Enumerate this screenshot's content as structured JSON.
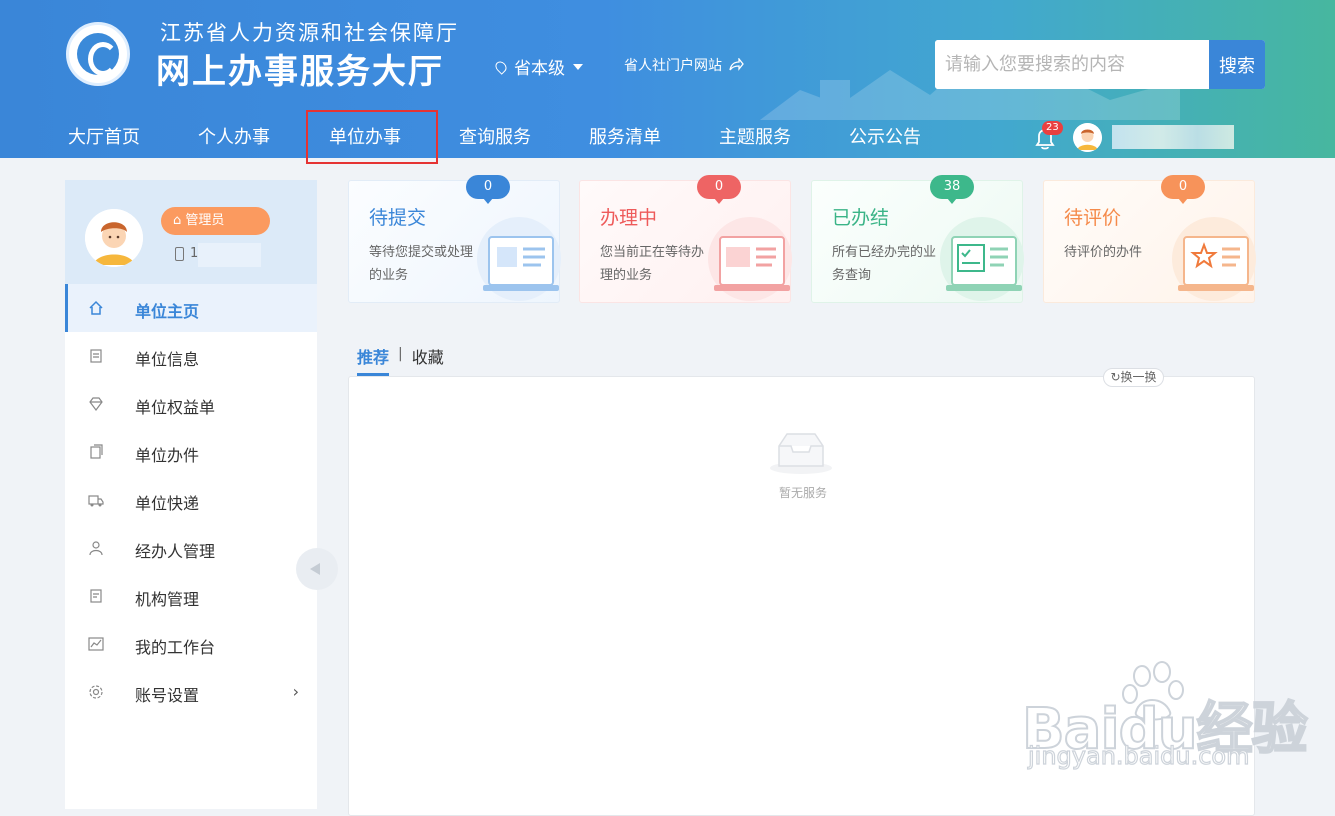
{
  "header": {
    "org_name": "江苏省人力资源和社会保障厅",
    "site_title": "网上办事服务大厅",
    "region": "省本级",
    "portal_link": "省人社门户网站",
    "search_placeholder": "请输入您要搜索的内容",
    "search_button": "搜索",
    "notification_count": "23"
  },
  "nav": {
    "items": [
      "大厅首页",
      "个人办事",
      "单位办事",
      "查询服务",
      "服务清单",
      "主题服务",
      "公示公告"
    ],
    "selected": "单位办事"
  },
  "sidebar": {
    "role_badge": "管理员",
    "phone_visible": "1",
    "items": [
      {
        "label": "单位主页",
        "icon": "home-icon",
        "active": true
      },
      {
        "label": "单位信息",
        "icon": "document-icon"
      },
      {
        "label": "单位权益单",
        "icon": "diamond-icon"
      },
      {
        "label": "单位办件",
        "icon": "files-icon"
      },
      {
        "label": "单位快递",
        "icon": "truck-icon"
      },
      {
        "label": "经办人管理",
        "icon": "user-icon"
      },
      {
        "label": "机构管理",
        "icon": "clipboard-icon"
      },
      {
        "label": "我的工作台",
        "icon": "chart-icon"
      },
      {
        "label": "账号设置",
        "icon": "gear-icon",
        "has_arrow": true
      }
    ]
  },
  "cards": [
    {
      "title": "待提交",
      "desc": "等待您提交或处理的业务",
      "count": "0",
      "color": "#3a86d8"
    },
    {
      "title": "办理中",
      "desc": "您当前正在等待办理的业务",
      "count": "0",
      "color": "#ee5a5a"
    },
    {
      "title": "已办结",
      "desc": "所有已经办完的业务查询",
      "count": "38",
      "color": "#3ab487"
    },
    {
      "title": "待评价",
      "desc": "待评价的办件",
      "count": "0",
      "color": "#f58a4a"
    }
  ],
  "tabs": {
    "active": "推荐",
    "inactive": "收藏"
  },
  "panel": {
    "refresh_label": "换一换",
    "empty_text": "暂无服务"
  },
  "watermark": {
    "brand": "Baidu经验",
    "url": "jingyan.baidu.com"
  }
}
